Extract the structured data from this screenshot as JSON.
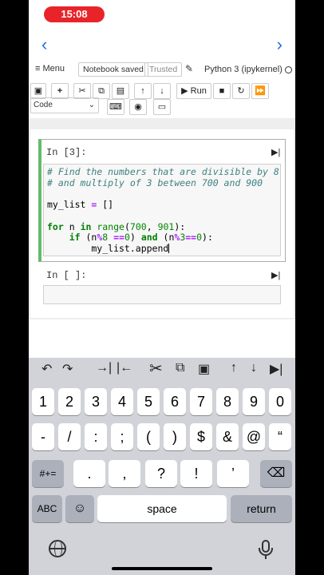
{
  "status_bar": {
    "time": "15:08"
  },
  "nav": {
    "back_icon": "‹",
    "forward_icon": "›"
  },
  "menubar": {
    "menu_label": "≡ Menu",
    "saved_label": "Notebook saved",
    "trusted_label": "Trusted",
    "kernel_label": "Python 3 (ipykernel)"
  },
  "toolbar": {
    "run_label": "▶ Run",
    "cell_type": "Code"
  },
  "cells": [
    {
      "prompt": "In [3]:",
      "code_lines": [
        "# Find the numbers that are divisible by 8",
        "# and multiply of 3 between 700 and 900",
        "",
        "my_list = []",
        "",
        "for n in range(700, 901):",
        "    if (n%8 ==0) and (n%3==0):",
        "        my_list.append"
      ]
    },
    {
      "prompt": "In [ ]:"
    }
  ],
  "keyboard": {
    "row1": [
      "1",
      "2",
      "3",
      "4",
      "5",
      "6",
      "7",
      "8",
      "9",
      "0"
    ],
    "row2": [
      "-",
      "/",
      ":",
      ";",
      "(",
      ")",
      "$",
      "&",
      "@",
      "“"
    ],
    "row3_toggle": "#+=",
    "row3": [
      ".",
      ",",
      "?",
      "!",
      "’"
    ],
    "abc_label": "ABC",
    "space_label": "space",
    "return_label": "return"
  }
}
